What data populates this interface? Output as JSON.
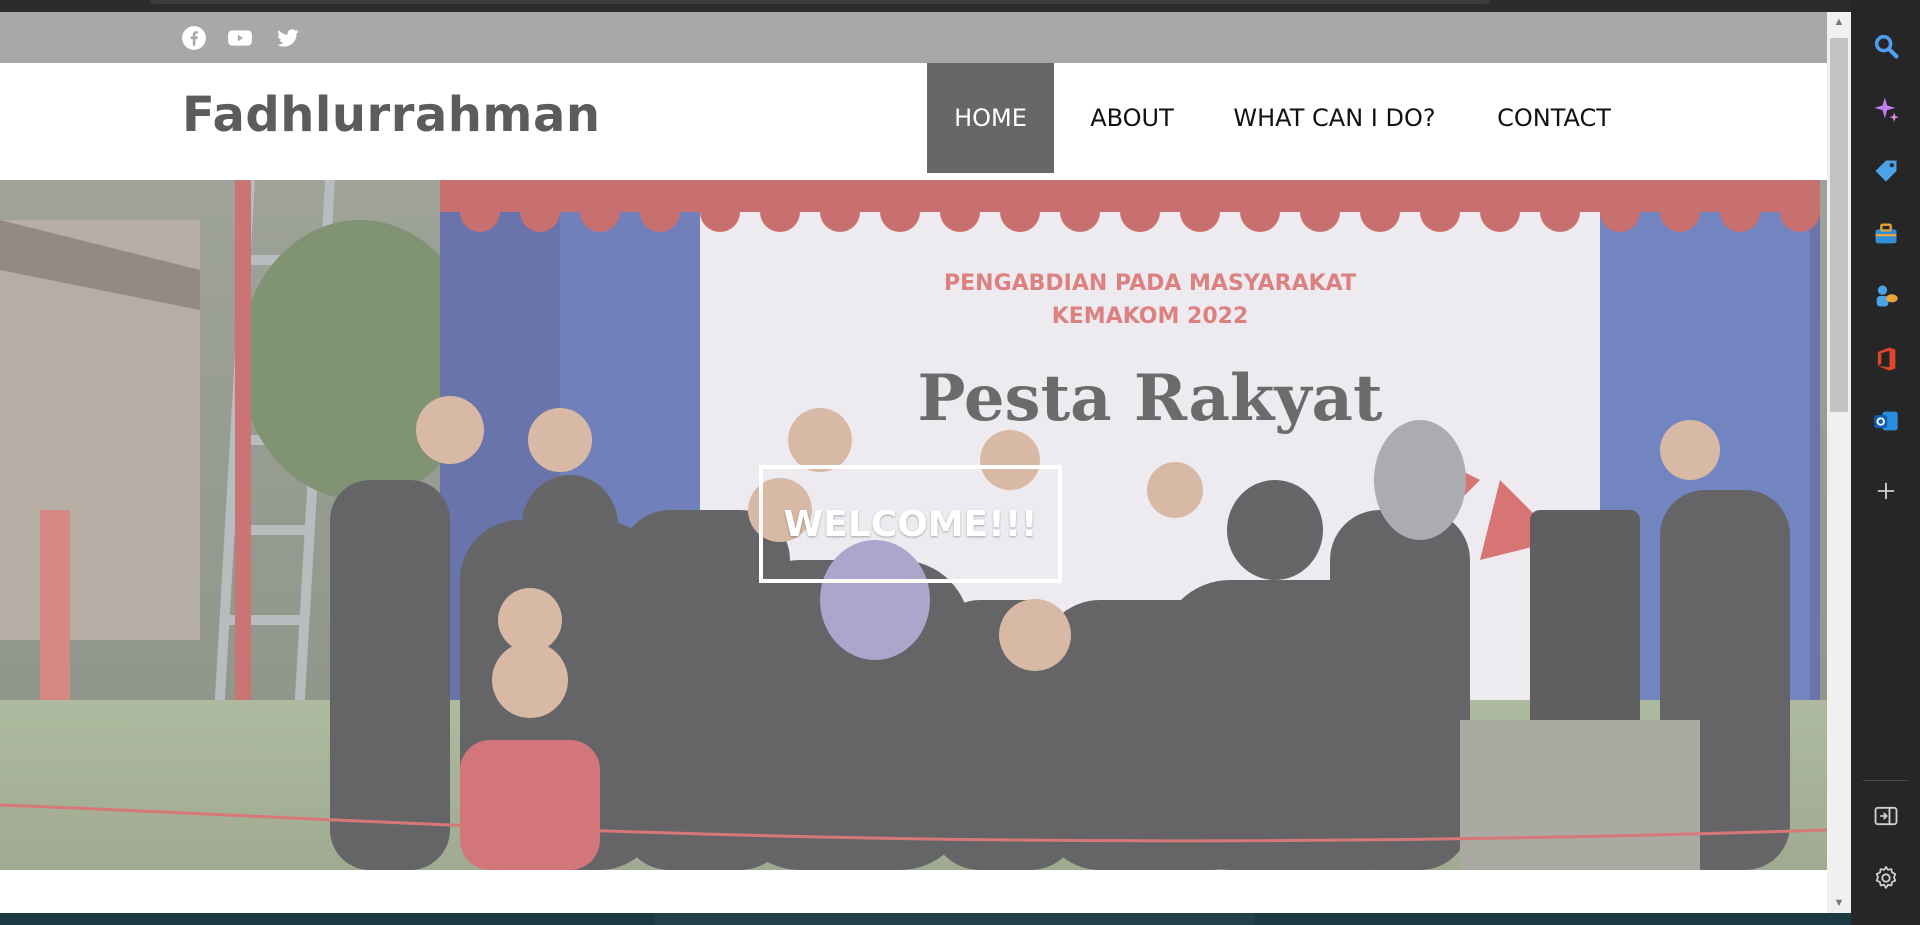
{
  "site": {
    "brand": "Fadhlurrahman",
    "social_icons": [
      "facebook-icon",
      "youtube-icon",
      "twitter-icon"
    ],
    "nav": [
      {
        "label": "HOME",
        "active": true
      },
      {
        "label": "ABOUT",
        "active": false
      },
      {
        "label": "WHAT CAN I DO?",
        "active": false
      },
      {
        "label": "CONTACT",
        "active": false
      }
    ],
    "hero": {
      "welcome_text": "WELCOME!!!",
      "banner_title": "PENGABDIAN PADA MASYARAKAT",
      "banner_subtitle": "KEMAKOM 2022",
      "banner_script": "Pesta Rakyat"
    }
  },
  "colors": {
    "social_bar": "#a8a8a8",
    "brand_text": "#5c5c5c",
    "nav_active_bg": "#676767",
    "sidebar_bg": "#262626"
  },
  "browser_sidebar": {
    "icons": [
      "search-icon",
      "copilot-icon",
      "shopping-tag-icon",
      "tools-icon",
      "games-icon",
      "office-icon",
      "outlook-icon",
      "add-icon",
      "split-screen-icon",
      "settings-icon"
    ]
  }
}
